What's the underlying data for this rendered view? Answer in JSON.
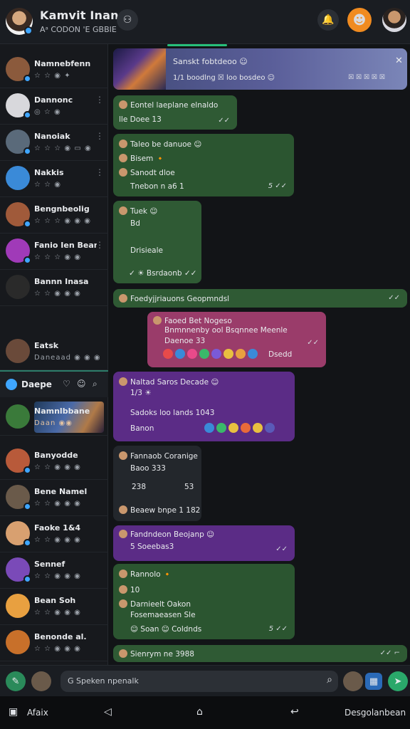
{
  "header": {
    "title": "Kamvit Inane",
    "subtitle": "Aᵃ CODON 'E GBBIE",
    "accent": "#27c07a"
  },
  "sidebar": {
    "items": [
      {
        "name": "Namnebfenn",
        "meta": "☆ ☆ ◉ ✦",
        "color": "#8b5a3c"
      },
      {
        "name": "Dannonc",
        "meta": "◎ ☆ ◉",
        "color": "#d8d8dc"
      },
      {
        "name": "Nanoiak",
        "meta": "☆ ☆ ☆ ◉ ▭ ◉",
        "color": "#5a6a7a"
      },
      {
        "name": "Nakkis",
        "meta": "☆ ☆ ◉",
        "color": "#3a8ad8"
      },
      {
        "name": "Bengnbeolig",
        "meta": "☆ ☆ ☆ ◉ ◉ ◉",
        "color": "#a05a3a"
      },
      {
        "name": "Fanio Ien Bean",
        "meta": "☆ ☆ ☆ ◉ ◉",
        "color": "#a03ab8"
      },
      {
        "name": "Bannn Inasa",
        "meta": "☆ ☆ ◉ ◉ ◉",
        "color": "#2a2a2a"
      },
      {
        "name": "Eatsk",
        "meta": "Daneaad  ◉  ◉  ◉",
        "color": "#6a4a3a"
      }
    ],
    "section": {
      "label": "Daepe",
      "icons": [
        "♡",
        "☺",
        "⌕"
      ]
    },
    "items2": [
      {
        "name": "Namnlbbane",
        "meta": "Daan  ◉◉",
        "color": "#3a7a3a"
      },
      {
        "name": "Banyodde",
        "meta": "☆ ☆ ◉ ◉ ◉",
        "color": "#b85a3a"
      },
      {
        "name": "Bene Namel",
        "meta": "☆ ☆ ◉ ◉ ◉",
        "color": "#6a5a4a"
      },
      {
        "name": "Faoke 1&4",
        "meta": "☆ ☆ ◉ ◉ ◉",
        "color": "#d8a070"
      },
      {
        "name": "Sennef",
        "meta": "☆ ☆ ◉ ◉ ◉",
        "color": "#7a4ab8"
      },
      {
        "name": "Bean Soh",
        "meta": "☆ ☆ ◉ ◉ ◉",
        "color": "#e8a040"
      },
      {
        "name": "Benonde al.",
        "meta": "☆ ☆ ◉ ◉ ◉",
        "color": "#c8702a"
      }
    ]
  },
  "chat": {
    "banner": {
      "title": "Sanskt fobtdeoo ☺",
      "subtitle": "1/1  boodlng  ☒  loo bosdeo ☺",
      "meta": "☒  ☒  ☒  ☒  ☒"
    },
    "m1": {
      "line1": "Eontel laeplane elnaldo",
      "line2": "lle  Doee 13",
      "ticks": "✓✓"
    },
    "m2": {
      "line1": "Taleo be danuoe ☺",
      "line2": "Bisem 🔸",
      "line3": "Sanodt dloe",
      "line4": "Tnebon  n a6 1",
      "ticks": "5 ✓✓"
    },
    "m3": {
      "line1": "Tuek ☺",
      "line2": "Bd",
      "line3": "Drisieale",
      "line4": "✓ ☀ Bsrdaonb ✓✓"
    },
    "m4": {
      "line1": "Foedyjjriauons Geopmndsl",
      "ticks": "✓✓"
    },
    "m5": {
      "line1": "Faoed Bet Nogeso",
      "line2": "Bnmnnenby ool Bsqnnee Meenle",
      "line3": "Daenoe 33",
      "line4": "Dsedd",
      "ticks": "✓✓"
    },
    "m6": {
      "line1": "Naltad  Saros Decade ☺",
      "line2": "1/3 ☀",
      "line3": "Sadoks loo lands 1043",
      "line4": "Banon"
    },
    "m7": {
      "line1": "Fannaob  Coranige",
      "line2": "Baoo 333",
      "line3": "238",
      "line4": "53",
      "line5": "Beaew bnpe 1 182"
    },
    "m8": {
      "line1": "Fandndeon Beojanp ☺",
      "line2": "5 Soeebas3",
      "ticks": "✓✓"
    },
    "m9": {
      "line1": "Rannolo 🔸",
      "line2": "10",
      "line3": "Darnieelt Oakon",
      "line4": "Fosemaeasen Sle",
      "line5": "☺  Soan  ☺  Coldnds",
      "ticks": "5 ✓✓"
    },
    "m10": {
      "line1": "Sienrym ne 3988",
      "ticks": "✓✓ ⌐"
    }
  },
  "composer": {
    "placeholder": "G Speken npenalk"
  },
  "navbar": {
    "left": "Afaix",
    "right": "Desgolanbean"
  }
}
